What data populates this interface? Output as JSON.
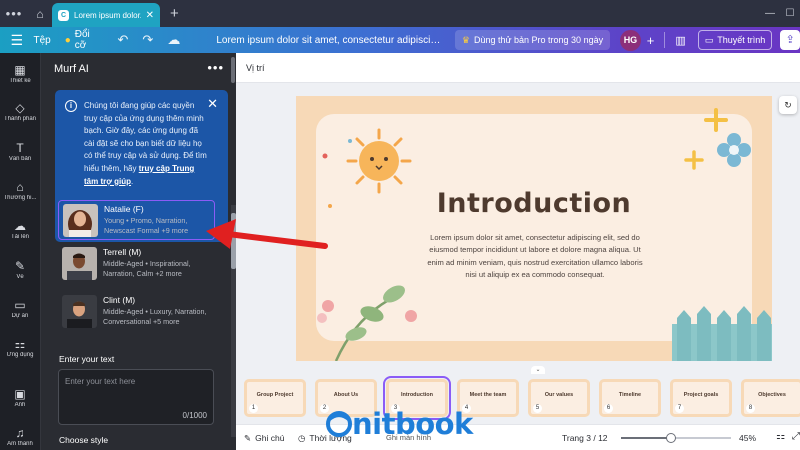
{
  "browser": {
    "tab_title": "Lorem ipsum dolor...",
    "tab_close": "✕",
    "new_tab": "+"
  },
  "toolbar": {
    "file_label": "Tệp",
    "resize_label": "Đổi cỡ",
    "doc_title": "Lorem ipsum dolor sit amet, consectetur adipiscing elit, se...",
    "pro_trial_label": "Dùng thử bản Pro trong 30 ngày",
    "avatar_initials": "HG",
    "present_label": "Thuyết trình"
  },
  "rail": {
    "items": [
      {
        "icon": "design-icon",
        "label": "Thiết kế"
      },
      {
        "icon": "elements-icon",
        "label": "Thành phần"
      },
      {
        "icon": "text-icon",
        "label": "Văn bản"
      },
      {
        "icon": "brand-icon",
        "label": "Thương hi..."
      },
      {
        "icon": "uploads-icon",
        "label": "Tải lên"
      },
      {
        "icon": "draw-icon",
        "label": "Vẽ"
      },
      {
        "icon": "projects-icon",
        "label": "Dự án"
      },
      {
        "icon": "apps-icon",
        "label": "Ứng dụng"
      },
      {
        "icon": "photos-icon",
        "label": "Ảnh"
      },
      {
        "icon": "audio-icon",
        "label": "Âm thanh"
      }
    ]
  },
  "panel": {
    "title": "Murf AI",
    "info_text": "Chúng tôi đang giúp các quyền truy cập của ứng dụng thêm minh bạch. Giờ đây, các ứng dụng đã cài đặt sẽ cho bạn biết dữ liệu họ có thể truy cập và sử dụng. Để tìm hiểu thêm, hãy",
    "info_link": "truy cập Trung tâm trợ giúp",
    "info_end": ".",
    "voices": [
      {
        "name": "Natalie (F)",
        "desc": "Young • Promo, Narration, Newscast Formal +9 more",
        "selected": true
      },
      {
        "name": "Terrell (M)",
        "desc": "Middle-Aged • Inspirational, Narration, Calm +2 more",
        "selected": false
      },
      {
        "name": "Clint (M)",
        "desc": "Middle-Aged • Luxury, Narration, Conversational +5 more",
        "selected": false
      }
    ],
    "enter_text_label": "Enter your text",
    "text_placeholder": "Enter your text here",
    "char_counter": "0/1000",
    "choose_style_label": "Choose style"
  },
  "canvas": {
    "position_label": "Vị trí",
    "slide_title": "Introduction",
    "slide_body": "Lorem ipsum dolor sit amet, consectetur adipiscing elit, sed do eiusmod tempor incididunt ut labore et dolore magna aliqua. Ut enim ad minim veniam, quis nostrud exercitation ullamco laboris nisi ut aliquip ex ea commodo consequat."
  },
  "thumbnails": [
    {
      "num": "1",
      "title": "Group Project"
    },
    {
      "num": "2",
      "title": "About Us"
    },
    {
      "num": "3",
      "title": "Introduction"
    },
    {
      "num": "4",
      "title": "Meet the team"
    },
    {
      "num": "5",
      "title": "Our values"
    },
    {
      "num": "6",
      "title": "Timeline"
    },
    {
      "num": "7",
      "title": "Project goals"
    },
    {
      "num": "8",
      "title": "Objectives"
    }
  ],
  "active_page": 3,
  "bottom": {
    "notes_label": "Ghi chú",
    "timer_label": "Thời lượng",
    "record_label": "Ghi màn hình",
    "page_label": "Trang 3 / 12",
    "zoom_label": "45%",
    "zoom_value": 0.45
  },
  "watermark": {
    "text": "nitbook"
  },
  "colors": {
    "accent": "#8b5cf6",
    "info_bg": "#1c56a7",
    "arrow": "#e02020",
    "slide_border": "#f7d9b7",
    "title_brown": "#4e3a2e"
  }
}
